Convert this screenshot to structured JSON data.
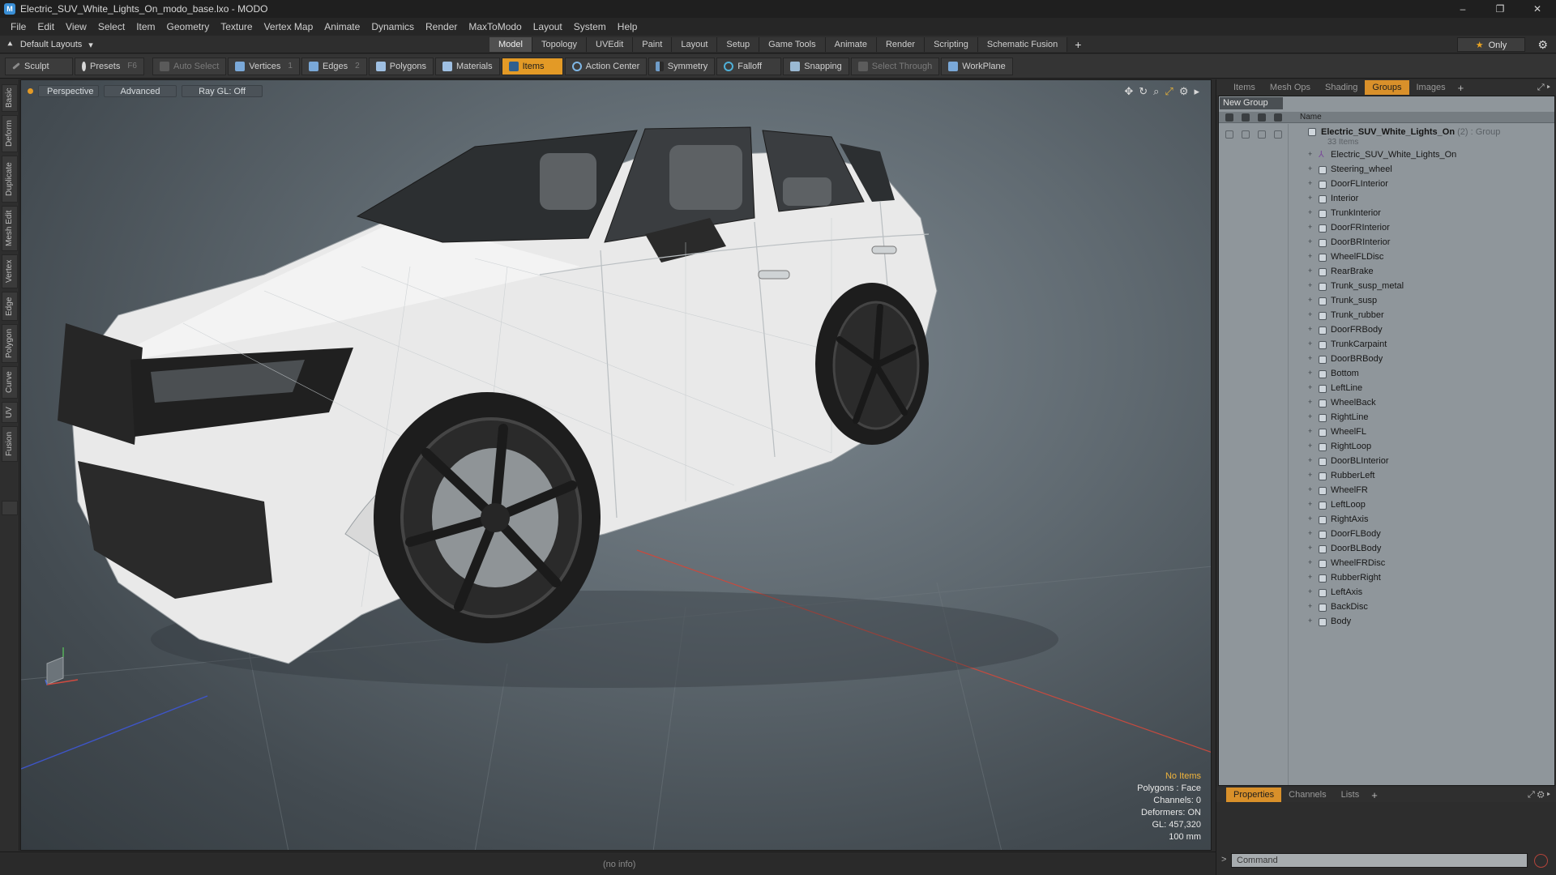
{
  "titlebar": {
    "app_icon": "modo-app-icon",
    "title": "Electric_SUV_White_Lights_On_modo_base.lxo - MODO",
    "minimize": "–",
    "maximize": "❐",
    "close": "✕"
  },
  "menu": [
    "File",
    "Edit",
    "View",
    "Select",
    "Item",
    "Geometry",
    "Texture",
    "Vertex Map",
    "Animate",
    "Dynamics",
    "Render",
    "MaxToModo",
    "Layout",
    "System",
    "Help"
  ],
  "layoutbar": {
    "layout": "Default Layouts",
    "tabs": [
      "Model",
      "Topology",
      "UVEdit",
      "Paint",
      "Layout",
      "Setup",
      "Game Tools",
      "Animate",
      "Render",
      "Scripting",
      "Schematic Fusion"
    ],
    "active_tab": "Model",
    "only_label": "Only"
  },
  "toolbar": {
    "sculpt": "Sculpt",
    "presets": "Presets",
    "presets_key": "F6",
    "auto_select": "Auto Select",
    "vertices": "Vertices",
    "vertices_key": "1",
    "edges": "Edges",
    "edges_key": "2",
    "polygons": "Polygons",
    "materials": "Materials",
    "items": "Items",
    "action_center": "Action Center",
    "symmetry": "Symmetry",
    "falloff": "Falloff",
    "snapping": "Snapping",
    "select_through": "Select Through",
    "workplane": "WorkPlane"
  },
  "left_tabs": [
    "Basic",
    "Deform",
    "Duplicate",
    "Mesh Edit",
    "Vertex",
    "Edge",
    "Polygon",
    "Curve",
    "UV",
    "Fusion"
  ],
  "viewport": {
    "view": "Perspective",
    "mode": "Advanced",
    "raygl": "Ray GL: Off",
    "info": {
      "items": "No Items",
      "polygons": "Polygons : Face",
      "channels": "Channels: 0",
      "deformers": "Deformers: ON",
      "gl": "GL: 457,320",
      "scale": "100 mm"
    }
  },
  "statusbar": {
    "text": "(no info)"
  },
  "panel_top": {
    "tabs": [
      "Items",
      "Mesh Ops",
      "Shading",
      "Groups",
      "Images"
    ],
    "active_tab": "Groups",
    "new_group": "New Group",
    "col_name": "Name",
    "root": {
      "name": "Electric_SUV_White_Lights_On",
      "count": "(2)",
      "type": ": Group",
      "subtitle": "33 Items"
    },
    "items": [
      "Electric_SUV_White_Lights_On",
      "Steering_wheel",
      "DoorFLInterior",
      "Interior",
      "TrunkInterior",
      "DoorFRInterior",
      "DoorBRInterior",
      "WheelFLDisc",
      "RearBrake",
      "Trunk_susp_metal",
      "Trunk_susp",
      "Trunk_rubber",
      "DoorFRBody",
      "TrunkCarpaint",
      "DoorBRBody",
      "Bottom",
      "LeftLine",
      "WheelBack",
      "RightLine",
      "WheelFL",
      "RightLoop",
      "DoorBLInterior",
      "RubberLeft",
      "WheelFR",
      "LeftLoop",
      "RightAxis",
      "DoorFLBody",
      "DoorBLBody",
      "WheelFRDisc",
      "RubberRight",
      "LeftAxis",
      "BackDisc",
      "Body"
    ]
  },
  "panel_bottom": {
    "tabs": [
      "Properties",
      "Channels",
      "Lists"
    ],
    "active_tab": "Properties",
    "command_placeholder": "Command"
  },
  "colors": {
    "accent": "#e39a26",
    "viewport_center": "#7d8890",
    "car_body": "#ececec",
    "tire": "#1d1d1d"
  }
}
